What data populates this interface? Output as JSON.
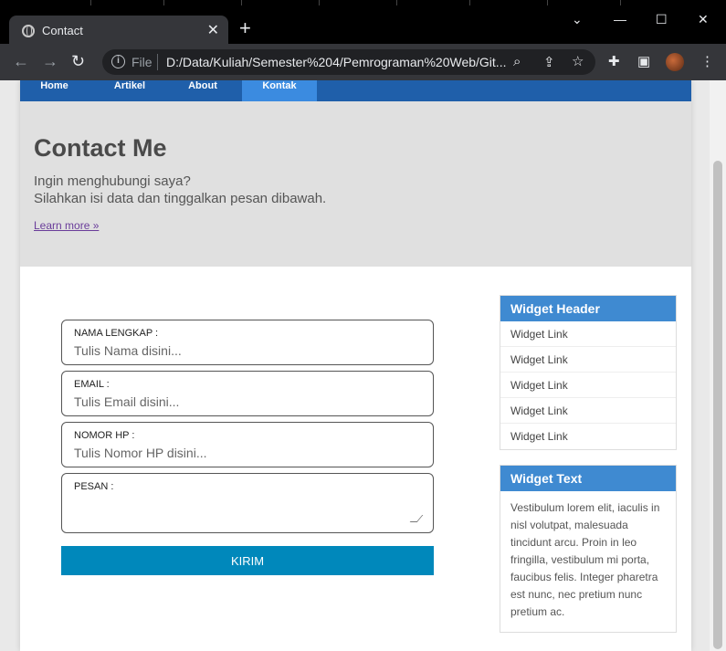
{
  "browser": {
    "tab_title": "Contact",
    "address_scheme_label": "File",
    "url": "D:/Data/Kuliah/Semester%204/Pemrograman%20Web/Git..."
  },
  "nav": {
    "items": [
      {
        "label": "Home"
      },
      {
        "label": "Artikel"
      },
      {
        "label": "About"
      },
      {
        "label": "Kontak"
      }
    ],
    "active": "Kontak",
    "color": "#1f5faa",
    "active_color": "#3b8be0"
  },
  "hero": {
    "title": "Contact Me",
    "line1": "Ingin menghubungi saya?",
    "line2": "Silahkan isi data dan tinggalkan pesan dibawah.",
    "learn_more": "Learn more »"
  },
  "form": {
    "nama_label": "NAMA LENGKAP :",
    "nama_placeholder": "Tulis Nama disini...",
    "email_label": "EMAIL :",
    "email_placeholder": "Tulis Email disini...",
    "hp_label": "NOMOR HP :",
    "hp_placeholder": "Tulis Nomor HP disini...",
    "pesan_label": "PESAN :",
    "submit_label": "KIRIM",
    "submit_color": "#0088bb"
  },
  "sidebar": {
    "widget_header_title": "Widget Header",
    "links": [
      "Widget Link",
      "Widget Link",
      "Widget Link",
      "Widget Link",
      "Widget Link"
    ],
    "widget_text_title": "Widget Text",
    "widget_text_body": "Vestibulum lorem elit, iaculis in nisl volutpat, malesuada tincidunt arcu. Proin in leo fringilla, vestibulum mi porta, faucibus felis. Integer pharetra est nunc, nec pretium nunc pretium ac.",
    "header_color": "#3f8ad1"
  }
}
